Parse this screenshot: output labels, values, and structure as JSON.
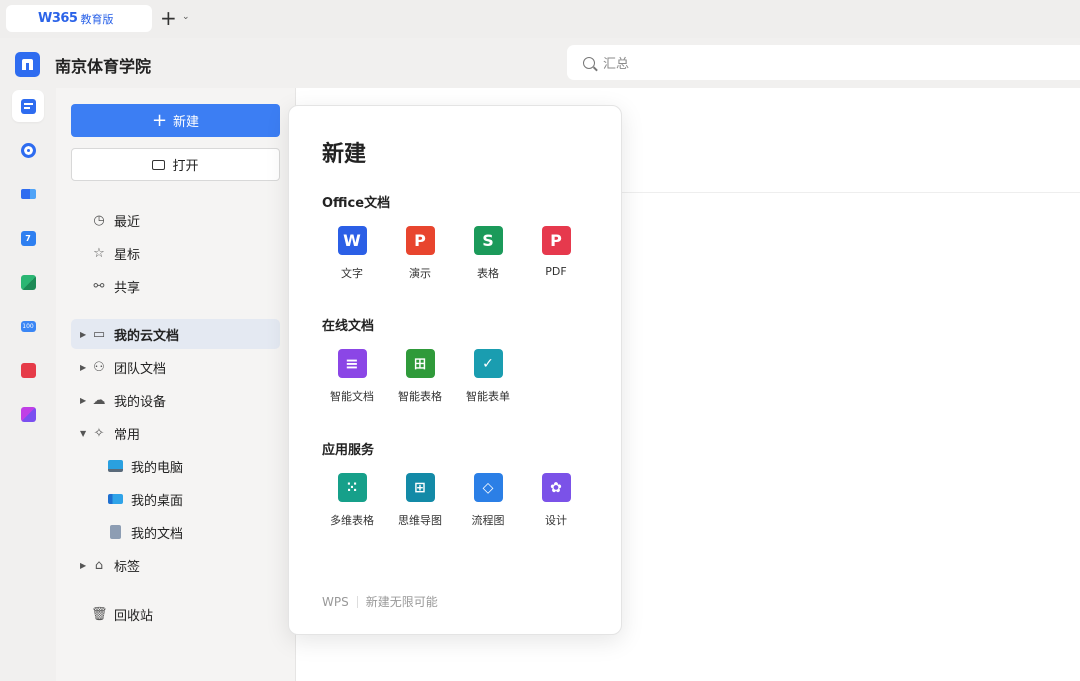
{
  "tabbar": {
    "tab_logo": "W365",
    "tab_edition": "教育版",
    "new_tab": "+",
    "new_tab_caret": "⌄"
  },
  "header": {
    "org_name": "南京体育学院",
    "search_placeholder": "汇总"
  },
  "sidebar": {
    "new_label": "新建",
    "open_label": "打开",
    "items": [
      {
        "label": "最近",
        "icon": "clock-icon"
      },
      {
        "label": "星标",
        "icon": "star-icon"
      },
      {
        "label": "共享",
        "icon": "share-icon"
      },
      {
        "label": "我的云文档",
        "icon": "folder-icon"
      },
      {
        "label": "团队文档",
        "icon": "team-icon"
      },
      {
        "label": "我的设备",
        "icon": "cloud-upload-icon"
      },
      {
        "label": "常用",
        "icon": "pin-icon"
      },
      {
        "label": "标签",
        "icon": "tag-icon"
      },
      {
        "label": "回收站",
        "icon": "trash-icon"
      }
    ],
    "sub_items": [
      {
        "label": "我的电脑",
        "icon": "computer-icon"
      },
      {
        "label": "我的桌面",
        "icon": "desktop-icon"
      },
      {
        "label": "我的文档",
        "icon": "document-icon"
      }
    ]
  },
  "popup": {
    "title": "新建",
    "sections": [
      {
        "title": "Office文档",
        "apps": [
          {
            "label": "文字",
            "glyph": "W",
            "color": "#2b5fe6"
          },
          {
            "label": "演示",
            "glyph": "P",
            "color": "#e8452e"
          },
          {
            "label": "表格",
            "glyph": "S",
            "color": "#1b9a5a"
          },
          {
            "label": "PDF",
            "glyph": "P",
            "color": "#e6394d"
          }
        ]
      },
      {
        "title": "在线文档",
        "apps": [
          {
            "label": "智能文档",
            "glyph": "≡",
            "color": "#8b46e6"
          },
          {
            "label": "智能表格",
            "glyph": "田",
            "color": "#2f9a3a"
          },
          {
            "label": "智能表单",
            "glyph": "✓",
            "color": "#1a9db0"
          }
        ]
      },
      {
        "title": "应用服务",
        "apps": [
          {
            "label": "多维表格",
            "glyph": "⁙",
            "color": "#16a08a"
          },
          {
            "label": "思维导图",
            "glyph": "⊞",
            "color": "#138aa7"
          },
          {
            "label": "流程图",
            "glyph": "◇",
            "color": "#2b7fe6"
          },
          {
            "label": "设计",
            "glyph": "✿",
            "color": "#7b52e8"
          }
        ]
      }
    ],
    "footer_brand": "WPS",
    "footer_slogan": "新建无限可能"
  }
}
